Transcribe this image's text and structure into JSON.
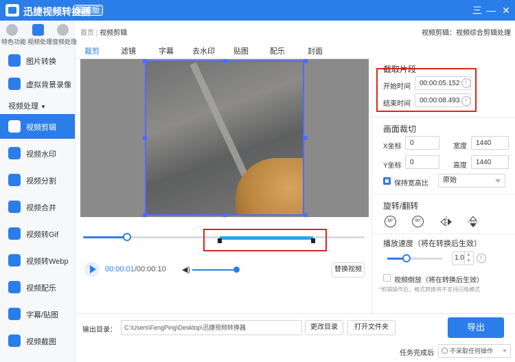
{
  "titlebar": {
    "app_title": "迅捷视频转换器",
    "edition_badge": "极速版",
    "window_buttons": [
      "三",
      "—",
      "□",
      "✕"
    ]
  },
  "top_icons": [
    {
      "label": "特色功能",
      "icon": "star-icon"
    },
    {
      "label": "视频处理",
      "icon": "film-icon"
    },
    {
      "label": "音频处理",
      "icon": "audio-icon"
    }
  ],
  "sidebar": {
    "section_label": "视频处理",
    "items": [
      {
        "label": "图片转换",
        "icon": "image-convert-icon"
      },
      {
        "label": "虚拟背景录像",
        "icon": "virtual-bg-icon"
      },
      {
        "label": "视频剪辑",
        "icon": "video-edit-icon"
      },
      {
        "label": "视频水印",
        "icon": "watermark-icon"
      },
      {
        "label": "视频分割",
        "icon": "split-icon"
      },
      {
        "label": "视频合并",
        "icon": "merge-icon"
      },
      {
        "label": "视频转Gif",
        "icon": "gif-icon"
      },
      {
        "label": "视频转Webp",
        "icon": "webp-icon"
      },
      {
        "label": "视频配乐",
        "icon": "music-icon"
      },
      {
        "label": "字幕/贴图",
        "icon": "subtitle-icon"
      },
      {
        "label": "视频截图",
        "icon": "screenshot-icon"
      }
    ],
    "active_index": 2
  },
  "breadcrumb": {
    "home": "首页",
    "separator": "|",
    "current": "视频剪辑",
    "right_text": "视频剪辑：视频综合剪辑处理"
  },
  "tabs": [
    "裁剪",
    "滤镜",
    "字幕",
    "去水印",
    "贴图",
    "配乐",
    "封面"
  ],
  "player": {
    "current_time": "00:00:01",
    "total_time": "/00:00:10",
    "progress": 0.14,
    "volume": 1.0,
    "volume_icon": "speaker-icon",
    "replace_button": "替换视频"
  },
  "panel": {
    "trim_title": "截取片段",
    "start_label": "开始时间",
    "start_value": "00:00:05.152",
    "end_label": "结束时间",
    "end_value": "00:00:08.493",
    "crop_title": "画面裁切",
    "x_label": "X坐标",
    "x_value": "0",
    "width_label": "宽度",
    "width_value": "1440",
    "y_label": "Y坐标",
    "y_value": "0",
    "height_label": "高度",
    "height_value": "1440",
    "keep_ratio_label": "保持宽高比",
    "keep_ratio_checked": true,
    "ratio_value": "原始",
    "rotate_title": "旋转/翻转",
    "rotate_ccw": "90°",
    "rotate_cw": "90°",
    "speed_title": "播放速度（将在转换后生效）",
    "speed_value": "1.0",
    "reverse_label": "视频倒放（将在转换后生效）",
    "reverse_checked": false,
    "note": "*剪辑操作后，格式转换将不支持闪电模式"
  },
  "bottom": {
    "output_label": "输出目录：",
    "output_path": "C:\\Users\\FengPing\\Desktop\\迅捷视频转换器",
    "change_dir": "更改目录",
    "open_folder": "打开文件夹",
    "export": "导出",
    "after_label": "任务完成后",
    "after_value": "不采取任何操作"
  },
  "colors": {
    "accent": "#2b7de9",
    "highlight_box": "#e2231a",
    "trim_range": "#2aa4ea"
  }
}
